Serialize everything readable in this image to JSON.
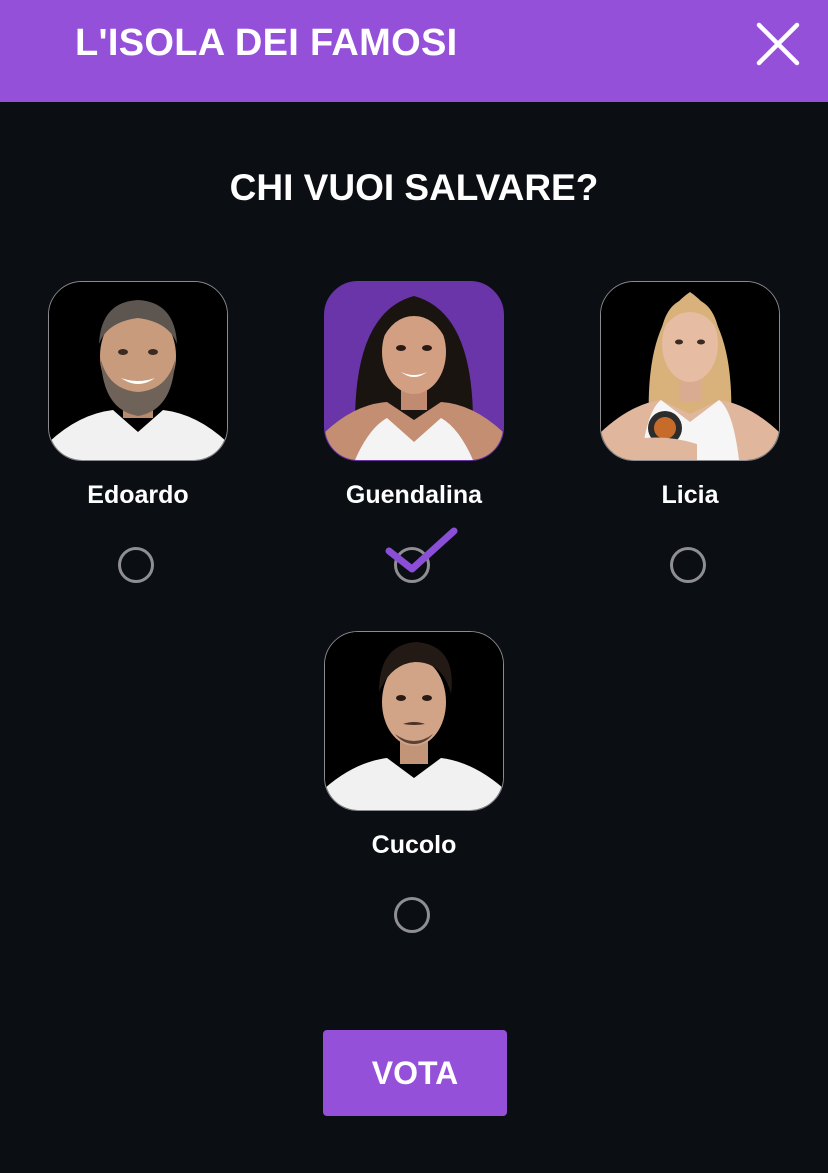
{
  "header": {
    "title": "L'ISOLA DEI FAMOSI",
    "close_icon": "close-icon"
  },
  "question": "CHI VUOI SALVARE?",
  "candidates": [
    {
      "name": "Edoardo",
      "selected": false
    },
    {
      "name": "Guendalina",
      "selected": true
    },
    {
      "name": "Licia",
      "selected": false
    },
    {
      "name": "Cucolo",
      "selected": false
    }
  ],
  "vote_button": {
    "label": "VOTA"
  },
  "colors": {
    "accent": "#9550d9",
    "selected_avatar_bg": "#6a35a8",
    "background": "#0b0f14",
    "radio_border": "#8e8e93",
    "check": "#8a4fd6"
  }
}
